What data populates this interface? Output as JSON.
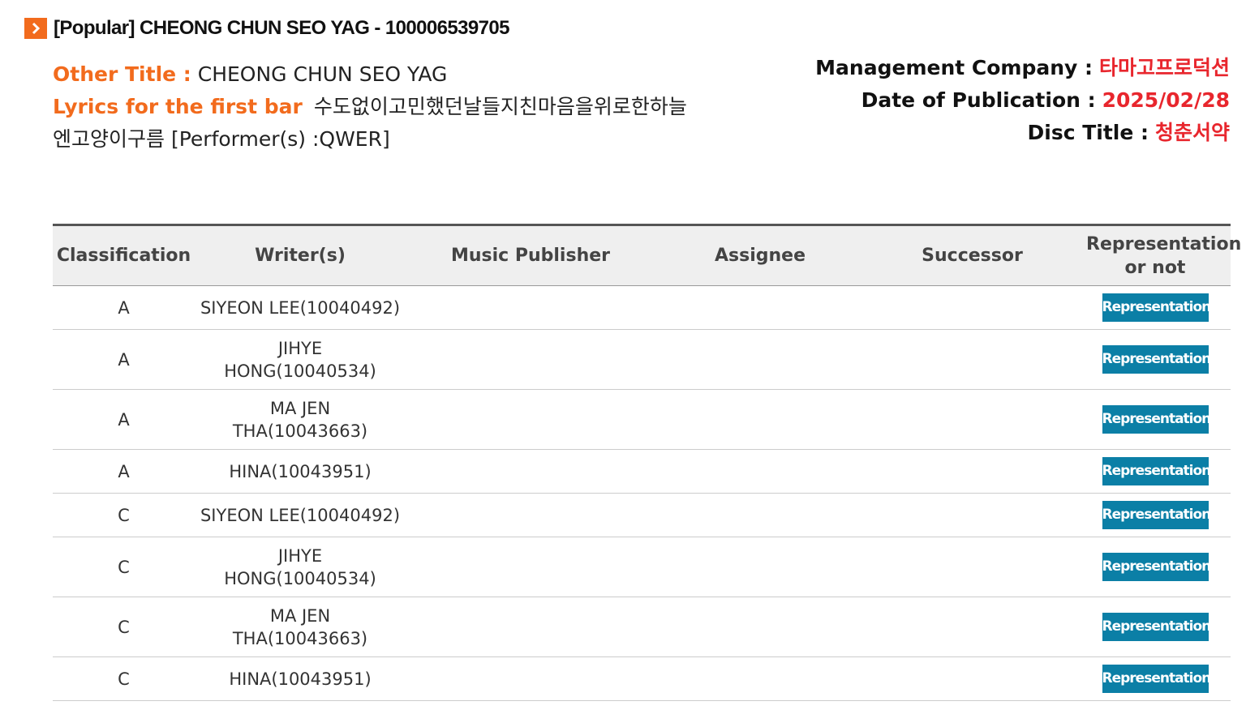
{
  "header": {
    "icon": "chevron-right-icon",
    "title": "[Popular] CHEONG CHUN SEO YAG - 100006539705"
  },
  "info": {
    "other_title_label": "Other Title :",
    "other_title_value": "CHEONG CHUN SEO YAG",
    "lyrics_label": "Lyrics for the first bar",
    "lyrics_value": "수도없이고민했던날들지친마음을위로한하늘",
    "lyrics_value_line2": "엔고양이구름",
    "performer": "[Performer(s) :QWER]",
    "management_label": "Management Company :",
    "management_value": "타마고프로덕션",
    "date_label": "Date of Publication :",
    "date_value": "2025/02/28",
    "disc_label": "Disc Title :",
    "disc_value": "청춘서약"
  },
  "table": {
    "columns": [
      "Classification",
      "Writer(s)",
      "Music Publisher",
      "Assignee",
      "Successor",
      "Representation or not"
    ],
    "rows": [
      {
        "classification": "A",
        "writer": "SIYEON LEE(10040492)",
        "publisher": "",
        "assignee": "",
        "successor": "",
        "representation": "Representation"
      },
      {
        "classification": "A",
        "writer": "JIHYE HONG(10040534)",
        "publisher": "",
        "assignee": "",
        "successor": "",
        "representation": "Representation"
      },
      {
        "classification": "A",
        "writer": "MA JEN THA(10043663)",
        "publisher": "",
        "assignee": "",
        "successor": "",
        "representation": "Representation"
      },
      {
        "classification": "A",
        "writer": "HINA(10043951)",
        "publisher": "",
        "assignee": "",
        "successor": "",
        "representation": "Representation"
      },
      {
        "classification": "C",
        "writer": "SIYEON LEE(10040492)",
        "publisher": "",
        "assignee": "",
        "successor": "",
        "representation": "Representation"
      },
      {
        "classification": "C",
        "writer": "JIHYE HONG(10040534)",
        "publisher": "",
        "assignee": "",
        "successor": "",
        "representation": "Representation"
      },
      {
        "classification": "C",
        "writer": "MA JEN THA(10043663)",
        "publisher": "",
        "assignee": "",
        "successor": "",
        "representation": "Representation"
      },
      {
        "classification": "C",
        "writer": "HINA(10043951)",
        "publisher": "",
        "assignee": "",
        "successor": "",
        "representation": "Representation"
      }
    ]
  },
  "colors": {
    "accent_orange": "#f26b1d",
    "value_red": "#e8262d",
    "button_blue": "#0b7fa6"
  }
}
